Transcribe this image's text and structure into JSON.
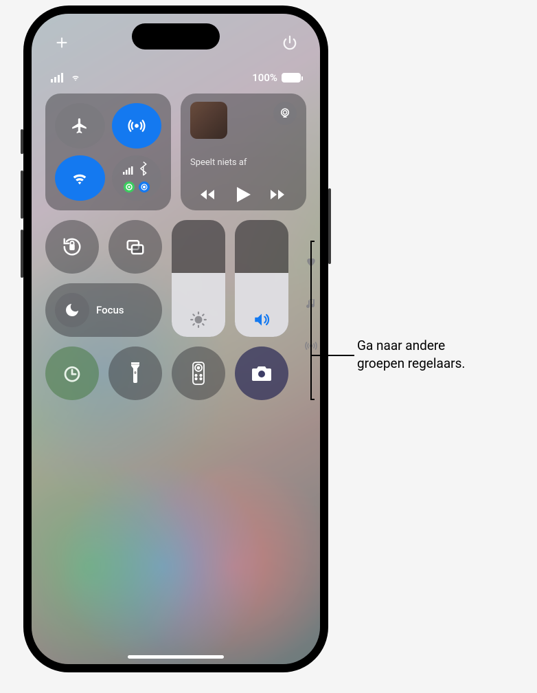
{
  "toprow": {
    "add_icon": "plus",
    "power_icon": "power"
  },
  "status": {
    "battery_pct": "100%"
  },
  "connectivity": {
    "airplane": {
      "active": false
    },
    "airdrop": {
      "active": true
    },
    "wifi": {
      "active": true
    },
    "cellular": {
      "active": false
    }
  },
  "music": {
    "now_playing_text": "Speelt niets af"
  },
  "focus": {
    "label": "Focus"
  },
  "sliders": {
    "brightness_pct": 55,
    "volume_pct": 55
  },
  "callout": {
    "line1": "Ga naar andere",
    "line2": "groepen regelaars."
  }
}
